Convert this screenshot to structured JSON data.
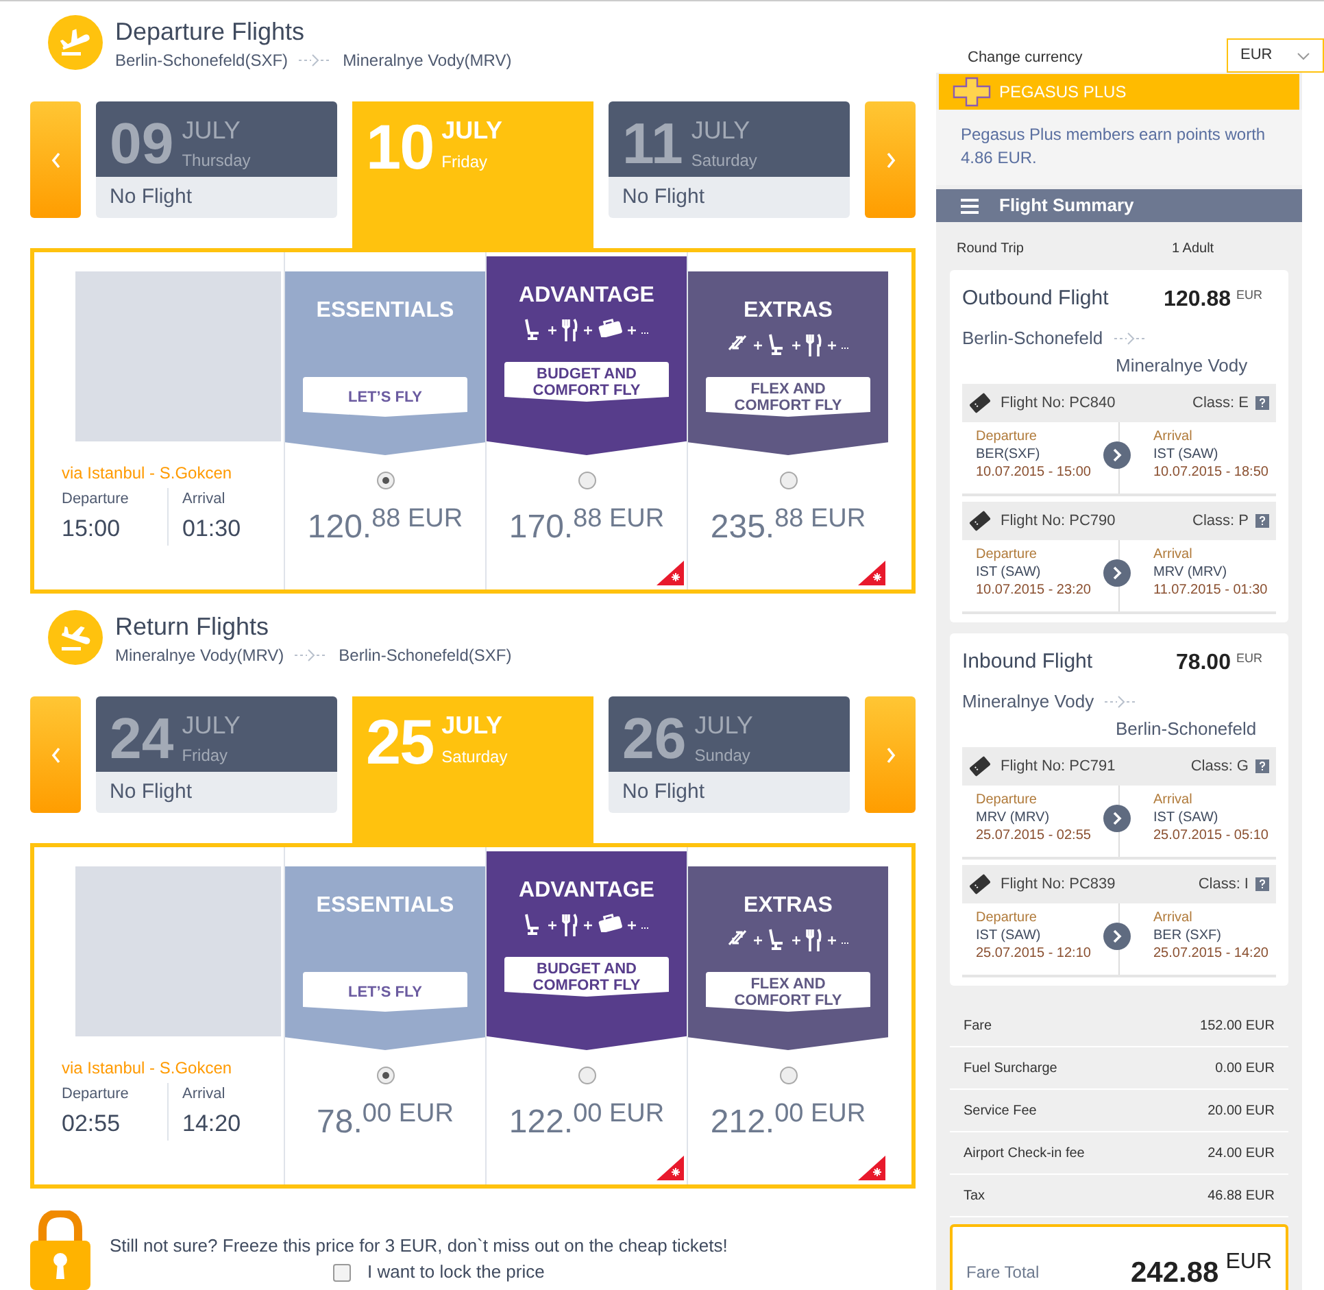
{
  "sections": [
    {
      "kind": "departure",
      "title": "Departure Flights",
      "from": "Berlin-Schonefeld(SXF)",
      "to": "Mineralnye Vody(MRV)",
      "dates": [
        {
          "day": "09",
          "month": "JULY",
          "weekday": "Thursday",
          "status": "No Flight",
          "selected": false
        },
        {
          "day": "10",
          "month": "JULY",
          "weekday": "Friday",
          "selected": true
        },
        {
          "day": "11",
          "month": "JULY",
          "weekday": "Saturday",
          "status": "No Flight",
          "selected": false
        }
      ],
      "via": "via Istanbul - S.Gokcen",
      "departure_label": "Departure",
      "departure_time": "15:00",
      "arrival_label": "Arrival",
      "arrival_time": "01:30",
      "fares": [
        {
          "kind": "essentials",
          "name": "ESSENTIALS",
          "tagline": "LET’S FLY",
          "price_main": "120.",
          "price_fraction": "88 EUR",
          "selected": true,
          "promo": false
        },
        {
          "kind": "advantage",
          "name": "ADVANTAGE",
          "amenities": [
            {
              "kind": "seat"
            },
            {
              "kind": "meal"
            },
            {
              "kind": "bag"
            }
          ],
          "tagline": "BUDGET AND COMFORT FLY",
          "price_main": "170.",
          "price_fraction": "88 EUR",
          "selected": false,
          "promo": true
        },
        {
          "kind": "extras",
          "name": "EXTRAS",
          "amenities": [
            {
              "kind": "change"
            },
            {
              "kind": "seat"
            },
            {
              "kind": "meal"
            }
          ],
          "tagline": "FLEX AND COMFORT FLY",
          "price_main": "235.",
          "price_fraction": "88 EUR",
          "selected": false,
          "promo": true
        }
      ]
    },
    {
      "kind": "return",
      "title": "Return Flights",
      "from": "Mineralnye Vody(MRV)",
      "to": "Berlin-Schonefeld(SXF)",
      "dates": [
        {
          "day": "24",
          "month": "JULY",
          "weekday": "Friday",
          "status": "No Flight",
          "selected": false
        },
        {
          "day": "25",
          "month": "JULY",
          "weekday": "Saturday",
          "selected": true
        },
        {
          "day": "26",
          "month": "JULY",
          "weekday": "Sunday",
          "status": "No Flight",
          "selected": false
        }
      ],
      "via": "via Istanbul - S.Gokcen",
      "departure_label": "Departure",
      "departure_time": "02:55",
      "arrival_label": "Arrival",
      "arrival_time": "14:20",
      "fares": [
        {
          "kind": "essentials",
          "name": "ESSENTIALS",
          "tagline": "LET’S FLY",
          "price_main": "78.",
          "price_fraction": "00 EUR",
          "selected": true,
          "promo": false
        },
        {
          "kind": "advantage",
          "name": "ADVANTAGE",
          "amenities": [
            {
              "kind": "seat"
            },
            {
              "kind": "meal"
            },
            {
              "kind": "bag"
            }
          ],
          "tagline": "BUDGET AND COMFORT FLY",
          "price_main": "122.",
          "price_fraction": "00 EUR",
          "selected": false,
          "promo": true
        },
        {
          "kind": "extras",
          "name": "EXTRAS",
          "amenities": [
            {
              "kind": "change"
            },
            {
              "kind": "seat"
            },
            {
              "kind": "meal"
            }
          ],
          "tagline": "FLEX AND COMFORT FLY",
          "price_main": "212.",
          "price_fraction": "00 EUR",
          "selected": false,
          "promo": true
        }
      ]
    }
  ],
  "lock": {
    "text": "Still not sure? Freeze this price for 3 EUR, don`t miss out on the cheap tickets!",
    "checkbox_label": "I want to lock the price",
    "checked": false
  },
  "currency": {
    "label": "Change currency",
    "value": "EUR"
  },
  "plus": {
    "title": "PEGASUS PLUS",
    "text": "Pegasus Plus members earn points worth 4.86 EUR."
  },
  "summary": {
    "title": "Flight Summary",
    "trip_type": "Round Trip",
    "passengers": "1 Adult",
    "flights": [
      {
        "title": "Outbound Flight",
        "amount": "120.88",
        "currency": "EUR",
        "from": "Berlin-Schonefeld",
        "to": "Mineralnye Vody",
        "legs": [
          {
            "flight_no": "Flight No: PC840",
            "class": "Class: E",
            "dep_label": "Departure",
            "dep_airport": "BER(SXF)",
            "dep_time": "10.07.2015 - 15:00",
            "arr_label": "Arrival",
            "arr_airport": "IST (SAW)",
            "arr_time": "10.07.2015 - 18:50"
          },
          {
            "flight_no": "Flight No: PC790",
            "class": "Class: P",
            "dep_label": "Departure",
            "dep_airport": "IST (SAW)",
            "dep_time": "10.07.2015 - 23:20",
            "arr_label": "Arrival",
            "arr_airport": "MRV (MRV)",
            "arr_time": "11.07.2015 - 01:30"
          }
        ]
      },
      {
        "title": "Inbound Flight",
        "amount": "78.00",
        "currency": "EUR",
        "from": "Mineralnye Vody",
        "to": "Berlin-Schonefeld",
        "legs": [
          {
            "flight_no": "Flight No: PC791",
            "class": "Class: G",
            "dep_label": "Departure",
            "dep_airport": "MRV (MRV)",
            "dep_time": "25.07.2015 - 02:55",
            "arr_label": "Arrival",
            "arr_airport": "IST (SAW)",
            "arr_time": "25.07.2015 - 05:10"
          },
          {
            "flight_no": "Flight No: PC839",
            "class": "Class: I",
            "dep_label": "Departure",
            "dep_airport": "IST (SAW)",
            "dep_time": "25.07.2015 - 12:10",
            "arr_label": "Arrival",
            "arr_airport": "BER (SXF)",
            "arr_time": "25.07.2015 - 14:20"
          }
        ]
      }
    ],
    "costs": [
      {
        "label": "Fare",
        "value": "152.00 EUR"
      },
      {
        "label": "Fuel Surcharge",
        "value": "0.00 EUR"
      },
      {
        "label": "Service Fee",
        "value": "20.00 EUR"
      },
      {
        "label": "Airport Check-in fee",
        "value": "24.00 EUR"
      },
      {
        "label": "Tax",
        "value": "46.88 EUR"
      }
    ],
    "total_label": "Fare Total",
    "total_amount": "242.88",
    "total_currency": "EUR"
  }
}
